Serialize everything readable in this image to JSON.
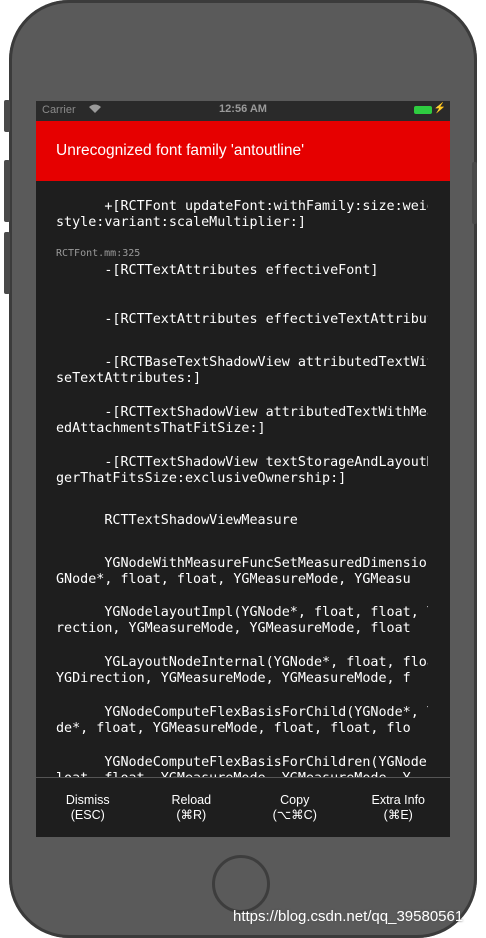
{
  "status_bar": {
    "carrier": "Carrier",
    "wifi_icon": "wifi-icon",
    "time": "12:56 AM",
    "battery_color": "#2ecc40"
  },
  "error": {
    "title": "Unrecognized font family 'antoutline'",
    "background": "#e60000"
  },
  "stack_frames": [
    {
      "text": "+[RCTFont updateFont:withFamily:size:weight:\nstyle:variant:scaleMultiplier:]",
      "sub": "RCTFont.mm:325"
    },
    {
      "text": "-[RCTTextAttributes effectiveFont]",
      "sub": ""
    },
    {
      "text": "-[RCTTextAttributes effectiveTextAttributes]",
      "sub": ""
    },
    {
      "text": "-[RCTBaseTextShadowView attributedTextWithBa\nseTextAttributes:]",
      "sub": ""
    },
    {
      "text": "-[RCTTextShadowView attributedTextWithMeasur\nedAttachmentsThatFitSize:]",
      "sub": ""
    },
    {
      "text": "-[RCTTextShadowView textStorageAndLayoutMana\ngerThatFitsSize:exclusiveOwnership:]",
      "sub": ""
    },
    {
      "text": "RCTTextShadowViewMeasure",
      "sub": ""
    },
    {
      "text": "YGNodeWithMeasureFuncSetMeasuredDimensions(Y\nGNode*, float, float, YGMeasureMode, YGMeasu",
      "sub": ""
    },
    {
      "text": "YGNodelayoutImpl(YGNode*, float, float, YGDi\nrection, YGMeasureMode, YGMeasureMode, float",
      "sub": ""
    },
    {
      "text": "YGLayoutNodeInternal(YGNode*, float, float,\nYGDirection, YGMeasureMode, YGMeasureMode, f",
      "sub": ""
    },
    {
      "text": "YGNodeComputeFlexBasisForChild(YGNode*, YGNo\nde*, float, YGMeasureMode, float, float, flo",
      "sub": ""
    },
    {
      "text": "YGNodeComputeFlexBasisForChildren(YGNode*, f\nloat, float, YGMeasureMode, YGMeasureMode, Y",
      "sub": ""
    }
  ],
  "buttons": [
    {
      "label": "Dismiss",
      "shortcut": "(ESC)"
    },
    {
      "label": "Reload",
      "shortcut": "(⌘R)"
    },
    {
      "label": "Copy",
      "shortcut": "(⌥⌘C)"
    },
    {
      "label": "Extra Info",
      "shortcut": "(⌘E)"
    }
  ],
  "watermark": "https://blog.csdn.net/qq_39580561"
}
